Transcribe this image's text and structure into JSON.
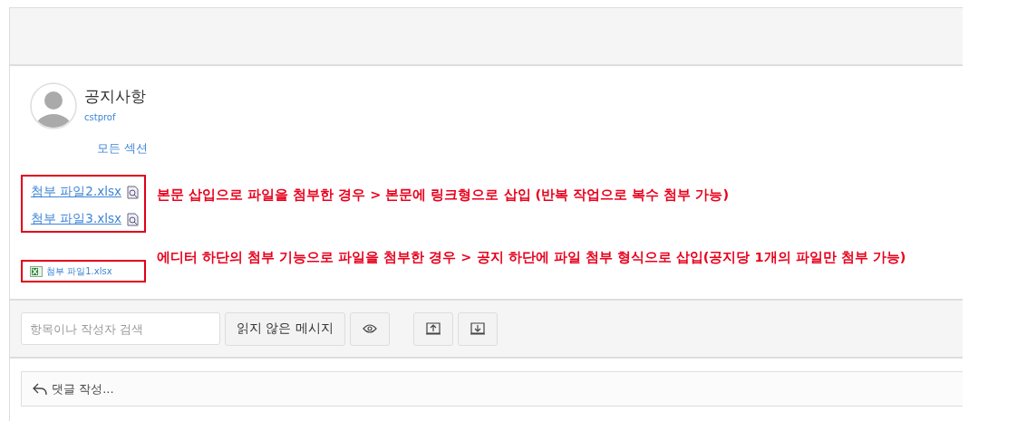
{
  "post": {
    "title": "공지사항",
    "author": "cstprof",
    "section_link": "모든 섹션"
  },
  "inline_attachments": [
    {
      "name": "첨부 파일2.xlsx"
    },
    {
      "name": "첨부 파일3.xlsx"
    }
  ],
  "inline_note": "본문 삽입으로 파일을 첨부한 경우 > 본문에 링크형으로 삽입 (반복 작업으로 복수 첨부 가능)",
  "attachment": {
    "name": "첨부 파일1.xlsx"
  },
  "attachment_note": "에디터 하단의 첨부 기능으로 파일을 첨부한 경우 > 공지 하단에 파일 첨부 형식으로 삽입(공지당 1개의 파일만 첨부 가능)",
  "toolbar": {
    "search": {
      "placeholder": "항목이나 작성자 검색"
    },
    "unread_button": "읽지 않은 메시지"
  },
  "reply": {
    "placeholder": "댓글 작성..."
  }
}
